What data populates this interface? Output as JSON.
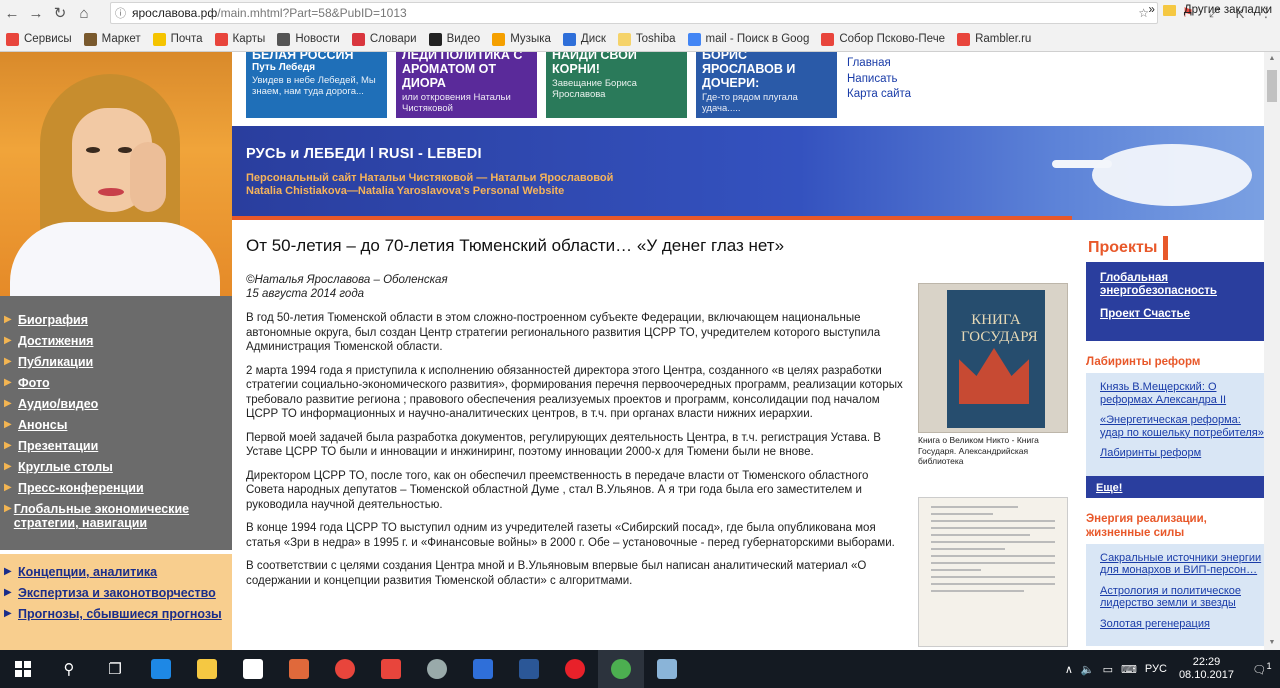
{
  "browser": {
    "url_host": "ярославова.рф",
    "url_path": "/main.mhtml?Part=58&PubID=1013",
    "nav": {
      "back": "←",
      "forward": "→",
      "reload": "↻",
      "home": "⌂"
    },
    "bookmarks": [
      {
        "label": "Сервисы",
        "color": "#e8453c"
      },
      {
        "label": "Маркет",
        "color": "#7a5a2e"
      },
      {
        "label": "Почта",
        "color": "#f5c400"
      },
      {
        "label": "Карты",
        "color": "#e8453c"
      },
      {
        "label": "Новости",
        "color": "#555"
      },
      {
        "label": "Словари",
        "color": "#d9363e"
      },
      {
        "label": "Видео",
        "color": "#222"
      },
      {
        "label": "Музыка",
        "color": "#f5a000"
      },
      {
        "label": "Диск",
        "color": "#2f6fd9"
      },
      {
        "label": "Toshiba",
        "color": "#f5d36a"
      },
      {
        "label": "mail - Поиск в Goog",
        "color": "#4285f4"
      },
      {
        "label": "Собор Псково-Пече",
        "color": "#e8453c"
      },
      {
        "label": "Rambler.ru",
        "color": "#e8453c"
      }
    ],
    "bookmarks_more": "»",
    "other_bookmarks": "Другие закладки"
  },
  "promos": [
    {
      "title": "Белая Россия",
      "subtitle": "Путь Лебедя",
      "text": "Увидев в небе Лебедей, Мы знаем, нам туда дорога...",
      "color": "#1f6fb8"
    },
    {
      "title": "Леди политика с ароматом от Диора",
      "subtitle": "",
      "text": "или откровения Натальи Чистяковой",
      "color": "#5a2a9a"
    },
    {
      "title": "Найди свои Корни!",
      "subtitle": "",
      "text": "Завещание Бориса Ярославова",
      "color": "#2a7a5a"
    },
    {
      "title": "Борис Ярославов и дочери:",
      "subtitle": "",
      "text": "Где-то рядом плугала удача.....",
      "color": "#2a5aa8"
    }
  ],
  "top_links": [
    "Главная",
    "Написать",
    "Карта сайта"
  ],
  "banner": {
    "title": "РУСЬ и ЛЕБЕДИ ǀ RUSI - LEBEDI",
    "sub1": "Персональный сайт Натальи Чистяковой — Натальи Ярославовой",
    "sub2": "Natalia Chistiakova—Natalia Yaroslavova's  Personal Website"
  },
  "left_nav": [
    "Биография",
    "Достижения",
    "Публикации",
    "Фото",
    "Аудио/видео",
    "Анонсы",
    "Презентации",
    "Круглые столы",
    "Пресс-конференции",
    "Глобальные экономические стратегии, навигации"
  ],
  "left_nav2": [
    "Концепции, аналитика",
    "Экспертиза и законотворчество",
    "Прогнозы, сбывшиеся прогнозы"
  ],
  "article": {
    "title": "От 50-летия – до 70-летия Тюменский области… «У денег глаз нет»",
    "author": "©Наталья Ярославова – Оболенская",
    "date": "15 августа 2014 года",
    "paragraphs": [
      "В год 50-летия Тюменской области в этом сложно-построенном субъекте Федерации, включающем национальные автономные округа, был создан Центр стратегии регионального развития ЦСРР ТО, учредителем которого выступила Администрация Тюменской области.",
      "2 марта 1994 года я приступила к исполнению обязанностей директора этого Центра, созданного «в целях разработки стратегии социально-экономического развития», формирования перечня первоочередных программ, реализации которых требовало развитие региона ; правового обеспечения реализуемых проектов и программ, консолидации под началом ЦСРР ТО информационных и научно-аналитических центров, в т.ч. при органах власти нижних иерархии.",
      "Первой моей задачей была разработка документов, регулирующих деятельность Центра, в т.ч. регистрация Устава. В Уставе ЦСРР ТО были и инновации и инжиниринг, поэтому инновации 2000-х для Тюмени были не внове.",
      "Директором ЦСРР ТО, после того, как он обеспечил преемственность в передаче власти от Тюменского областного Совета народных депутатов – Тюменской областной Думе , стал В.Ульянов. А я три года была его заместителем и руководила научной деятельностью.",
      "В конце 1994 года ЦСРР ТО выступил одним из учредителей газеты «Сибирский посад», где была опубликована моя статья «Зри в недра» в 1995 г. и «Финансовые войны» в 2000 г. Обе – установочные - перед губернаторскими выборами.",
      "В соответствии с целями создания Центра мной и В.Ульяновым впервые был написан аналитический материал «О содержании и концепции развития Тюменской области» с алгоритмами."
    ]
  },
  "figures": {
    "book_text": "КНИГА ГОСУДАРЯ",
    "book_caption": "Книга о Великом Никто - Книга Государя. Александрийская библиотека"
  },
  "right": {
    "projects_title": "Проекты",
    "projects": [
      "Глобальная энергобезопасность",
      "Проект Счастье"
    ],
    "labyrinth_title": "Лабиринты реформ",
    "labyrinth": [
      "Князь В.Мещерский: О реформах Александра II",
      "«Энергетическая реформа: удар по кошельку потребителя»",
      "Лабиринты реформ"
    ],
    "more": "Еще!",
    "energy_title": "Энергия реализации, жизненные силы",
    "energy": [
      "Сакральные источники энергии для монархов и ВИП-персон…",
      "Астрология и политическое лидерство земли и звезды",
      "Золотая регенерация"
    ]
  },
  "taskbar": {
    "lang": "РУС",
    "time": "22:29",
    "date": "08.10.2017",
    "notif": "1"
  }
}
